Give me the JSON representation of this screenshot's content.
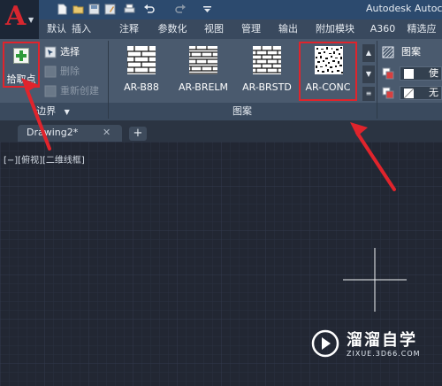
{
  "titlebar": {
    "app_title": "Autodesk Autoc",
    "quick_access_icons": [
      "new-file-icon",
      "open-folder-icon",
      "save-icon",
      "save-as-icon",
      "print-icon",
      "undo-icon",
      "redo-icon",
      "customize-dropdown-icon"
    ]
  },
  "menu": {
    "tabs": [
      "默认",
      "插入",
      "注释",
      "参数化",
      "视图",
      "管理",
      "输出",
      "附加模块",
      "A360",
      "精选应"
    ]
  },
  "ribbon": {
    "boundary_panel": {
      "pick_points_label": "拾取点",
      "select_label": "选择",
      "remove_label": "删除",
      "recreate_label": "重新创建",
      "title": "边界"
    },
    "pattern_panel": {
      "title": "图案",
      "swatches": [
        "AR-B88",
        "AR-BRELM",
        "AR-BRSTD",
        "AR-CONC"
      ],
      "selected": "AR-CONC"
    },
    "properties_panel": {
      "type_value": "图案",
      "color_value": "使",
      "background_value": "无"
    }
  },
  "document": {
    "tab_name": "Drawing2*",
    "close_symbol": "✕",
    "new_tab_symbol": "+"
  },
  "canvas": {
    "viewport_label": "[−][俯视][二维线框]"
  },
  "watermark": {
    "title": "溜溜自学",
    "url": "ZIXUE.3D66.COM"
  },
  "colors": {
    "highlight": "#e0242c",
    "canvas_bg": "#222733",
    "ribbon_bg": "#4a5a6e"
  }
}
